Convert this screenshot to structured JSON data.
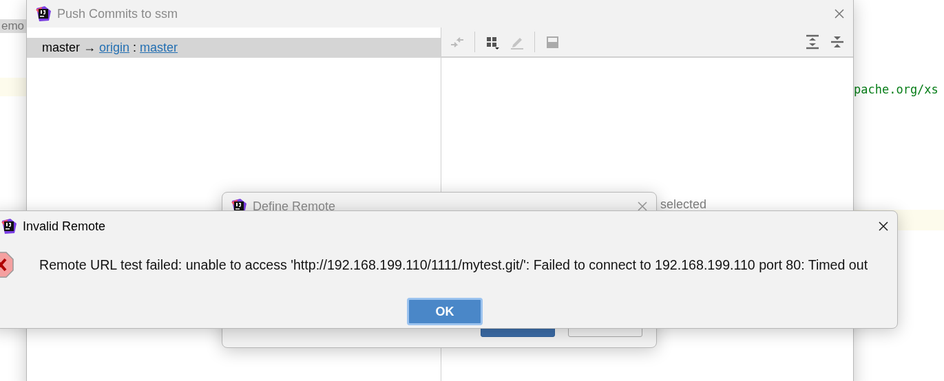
{
  "background_editor": {
    "tab_label": "emo",
    "code_text": "pache.org/xs"
  },
  "push_window": {
    "title": "Push Commits to ssm",
    "branch_row": {
      "local": "master",
      "arrow": "→",
      "remote": "origin",
      "separator": ":",
      "remote_branch": "master",
      "selected": true
    },
    "right_pane_status": "selected"
  },
  "define_remote": {
    "title": "Define Remote"
  },
  "error_dialog": {
    "title": "Invalid Remote",
    "message": "Remote URL test failed: unable to access 'http://192.168.199.110/1111/mytest.git/': Failed to connect to 192.168.199.110 port 80: Timed out",
    "buttons": [
      {
        "label": "OK",
        "default": true
      }
    ]
  }
}
